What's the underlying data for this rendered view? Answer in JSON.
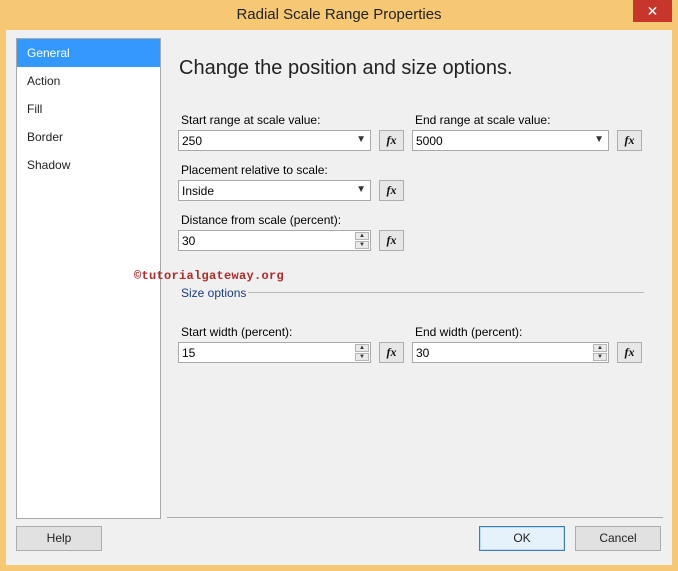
{
  "window": {
    "title": "Radial Scale Range Properties",
    "close_glyph": "✕"
  },
  "sidebar": {
    "items": [
      {
        "label": "General",
        "selected": true
      },
      {
        "label": "Action",
        "selected": false
      },
      {
        "label": "Fill",
        "selected": false
      },
      {
        "label": "Border",
        "selected": false
      },
      {
        "label": "Shadow",
        "selected": false
      }
    ]
  },
  "main": {
    "heading": "Change the position and size options.",
    "start_range_label": "Start range at scale value:",
    "start_range_value": "250",
    "end_range_label": "End range at scale value:",
    "end_range_value": "5000",
    "placement_label": "Placement relative to scale:",
    "placement_value": "Inside",
    "distance_label": "Distance from scale (percent):",
    "distance_value": "30",
    "watermark": "©tutorialgateway.org",
    "size_section": "Size options",
    "start_width_label": "Start width (percent):",
    "start_width_value": "15",
    "end_width_label": "End width (percent):",
    "end_width_value": "30",
    "fx_label": "fx"
  },
  "footer": {
    "help_label": "Help",
    "ok_label": "OK",
    "cancel_label": "Cancel"
  },
  "colors": {
    "titlebar": "#f7c873",
    "close_button": "#c7352b",
    "selection": "#3399ff"
  },
  "icons": {
    "dropdown": "chevron-down-icon",
    "spin_up": "spin-up-icon",
    "spin_down": "spin-down-icon",
    "expression": "fx-icon"
  }
}
